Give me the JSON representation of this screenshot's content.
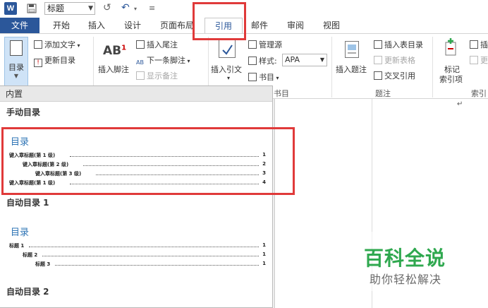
{
  "qat": {
    "app_icon": "W",
    "style_value": "标题",
    "undo_icon": "undo-icon",
    "redo_icon": "redo-icon"
  },
  "tabs": [
    {
      "label": "文件"
    },
    {
      "label": "开始"
    },
    {
      "label": "插入"
    },
    {
      "label": "设计"
    },
    {
      "label": "页面布局"
    },
    {
      "label": "引用"
    },
    {
      "label": "邮件"
    },
    {
      "label": "审阅"
    },
    {
      "label": "视图"
    }
  ],
  "ribbon": {
    "toc": {
      "button": "目录",
      "add_text": "添加文字",
      "update_toc": "更新目录"
    },
    "footnotes": {
      "big_label": "AB",
      "big_sup": "1",
      "insert_footnote": "插入脚注",
      "insert_endnote": "插入尾注",
      "next_footnote": "下一条脚注",
      "show_notes": "显示备注"
    },
    "citations": {
      "insert_citation": "插入引文",
      "manage_sources": "管理源",
      "style_label": "样式:",
      "style_value": "APA",
      "bibliography": "书目",
      "group_label": "书目"
    },
    "captions": {
      "insert_caption": "插入题注",
      "insert_table_figures": "插入表目录",
      "update_table": "更新表格",
      "cross_reference": "交叉引用",
      "group_label": "题注"
    },
    "index": {
      "mark_entry_line1": "标记",
      "mark_entry_line2": "索引项",
      "insert": "插",
      "update": "更",
      "group_label": "索引"
    }
  },
  "gallery": {
    "header": "内置",
    "manual_title": "手动目录",
    "auto1_title": "自动目录 1",
    "auto2_title": "自动目录 2",
    "toc_heading": "目录",
    "manual_entries": [
      {
        "text": "键入章标题(第 1 级)",
        "page": "1"
      },
      {
        "text": "键入章标题(第 2 级)",
        "page": "2"
      },
      {
        "text": "键入章标题(第 3 级)",
        "page": "3"
      },
      {
        "text": "键入章标题(第 1 级)",
        "page": "4"
      }
    ],
    "auto_entries": [
      {
        "text": "标题 1",
        "page": "1"
      },
      {
        "text": "标题 2",
        "page": "1"
      },
      {
        "text": "标题 3",
        "page": "1"
      }
    ]
  },
  "document": {
    "paragraph_mark": "↵"
  },
  "watermark": {
    "title": "百科全说",
    "subtitle": "助你轻松解决"
  },
  "colors": {
    "accent": "#2b579a",
    "highlight": "#e03a3a",
    "toc_heading": "#2e74b5",
    "watermark": "#2fa84f"
  }
}
